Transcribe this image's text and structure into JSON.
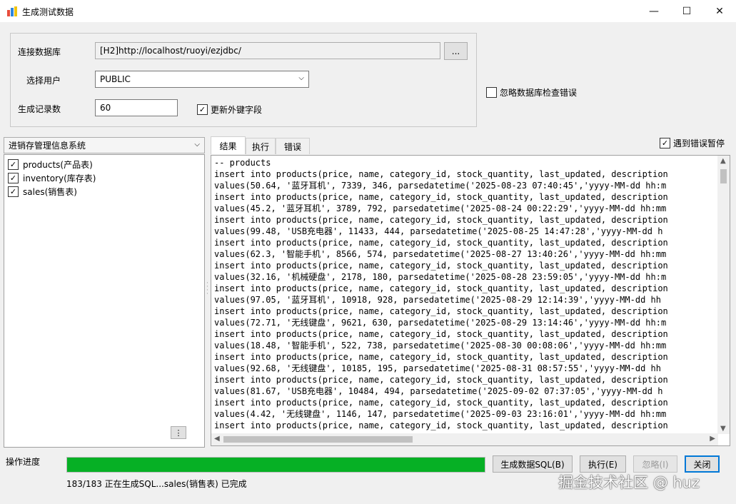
{
  "window": {
    "title": "生成测试数据",
    "minimize": "—",
    "maximize": "☐",
    "close": "✕"
  },
  "connection": {
    "db_label": "连接数据库",
    "db_value": "[H2]http://localhost/ruoyi/ezjdbc/",
    "browse_label": "...",
    "user_label": "选择用户",
    "user_value": "PUBLIC",
    "count_label": "生成记录数",
    "count_value": "60",
    "update_fk_label": "更新外键字段",
    "update_fk_checked": true
  },
  "ignore_check_label": "忽略数据库检查错误",
  "pause_on_error_label": "遇到错误暂停",
  "system_select": {
    "value": "进销存管理信息系统"
  },
  "tables": [
    {
      "label": "products(产品表)",
      "checked": true
    },
    {
      "label": "inventory(库存表)",
      "checked": true
    },
    {
      "label": "sales(销售表)",
      "checked": true
    }
  ],
  "tabs": [
    {
      "label": "结果",
      "active": true
    },
    {
      "label": "执行",
      "active": false
    },
    {
      "label": "错误",
      "active": false
    }
  ],
  "code_lines": [
    "-- products",
    "insert into products(price, name, category_id, stock_quantity, last_updated, description",
    "values(50.64, '蓝牙耳机', 7339, 346, parsedatetime('2025-08-23 07:40:45','yyyy-MM-dd hh:m",
    "insert into products(price, name, category_id, stock_quantity, last_updated, description",
    "values(45.2, '蓝牙耳机', 3789, 792, parsedatetime('2025-08-24 00:22:29','yyyy-MM-dd hh:mm",
    "insert into products(price, name, category_id, stock_quantity, last_updated, description",
    "values(99.48, 'USB充电器', 11433, 444, parsedatetime('2025-08-25 14:47:28','yyyy-MM-dd h",
    "insert into products(price, name, category_id, stock_quantity, last_updated, description",
    "values(62.3, '智能手机', 8566, 574, parsedatetime('2025-08-27 13:40:26','yyyy-MM-dd hh:mm",
    "insert into products(price, name, category_id, stock_quantity, last_updated, description",
    "values(32.16, '机械硬盘', 2178, 180, parsedatetime('2025-08-28 23:59:05','yyyy-MM-dd hh:m",
    "insert into products(price, name, category_id, stock_quantity, last_updated, description",
    "values(97.05, '蓝牙耳机', 10918, 928, parsedatetime('2025-08-29 12:14:39','yyyy-MM-dd hh",
    "insert into products(price, name, category_id, stock_quantity, last_updated, description",
    "values(72.71, '无线键盘', 9621, 630, parsedatetime('2025-08-29 13:14:46','yyyy-MM-dd hh:m",
    "insert into products(price, name, category_id, stock_quantity, last_updated, description",
    "values(18.48, '智能手机', 522, 738, parsedatetime('2025-08-30 00:08:06','yyyy-MM-dd hh:mm",
    "insert into products(price, name, category_id, stock_quantity, last_updated, description",
    "values(92.68, '无线键盘', 10185, 195, parsedatetime('2025-08-31 08:57:55','yyyy-MM-dd hh",
    "insert into products(price, name, category_id, stock_quantity, last_updated, description",
    "values(81.67, 'USB充电器', 10484, 494, parsedatetime('2025-09-02 07:37:05','yyyy-MM-dd h",
    "insert into products(price, name, category_id, stock_quantity, last_updated, description",
    "values(4.42, '无线键盘', 1146, 147, parsedatetime('2025-09-03 23:16:01','yyyy-MM-dd hh:mm",
    "insert into products(price, name, category_id, stock_quantity, last_updated, description"
  ],
  "progress": {
    "label": "操作进度",
    "fraction": 1.0,
    "status_text": "183/183 正在生成SQL...sales(销售表) 已完成"
  },
  "buttons": {
    "generate": "生成数据SQL(B)",
    "execute": "执行(E)",
    "ignore": "忽略(I)",
    "close": "关闭"
  },
  "watermark": "掘金技术社区 @ huz",
  "colors": {
    "progress": "#06b025",
    "accent": "#0078d7"
  }
}
